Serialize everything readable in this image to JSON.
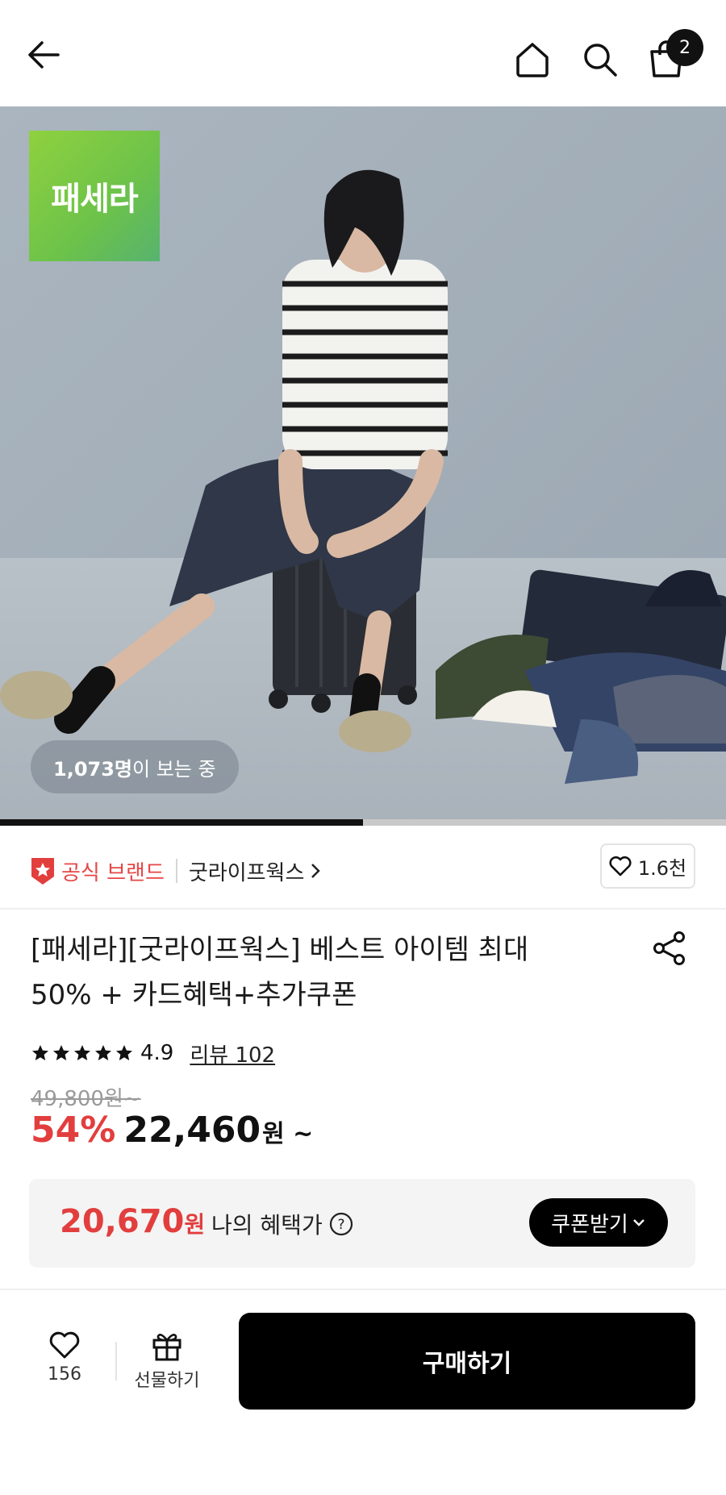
{
  "header": {
    "back_icon": "arrow-left-icon",
    "home_icon": "home-icon",
    "search_icon": "search-icon",
    "cart_icon": "shopping-bag-icon",
    "cart_badge": "2"
  },
  "hero": {
    "brand_logo_text": "패세라",
    "viewers_count": "1,073명",
    "viewers_suffix": "이 보는 중",
    "image_progress": 0.5
  },
  "brand": {
    "official_icon": "star-badge-icon",
    "official_label": "공식 브랜드",
    "brand_name": "굿라이프웍스",
    "like_count": "1.6천"
  },
  "product": {
    "title_line1": "[패세라][굿라이프웍스] 베스트 아이템 최대",
    "title_line2": "50% + 카드혜택+추가쿠폰",
    "share_icon": "share-icon",
    "rating": "4.9",
    "stars": 5,
    "review_label": "리뷰 102",
    "original_price": "49,800원~",
    "discount_rate": "54%",
    "price": "22,460",
    "price_unit": "원 ~"
  },
  "benefit": {
    "price": "20,670",
    "price_unit": "원",
    "label": "나의 혜택가",
    "help_icon": "question-circle-icon",
    "coupon_button": "쿠폰받기"
  },
  "bottom_bar": {
    "wish_count": "156",
    "gift_label": "선물하기",
    "buy_label": "구매하기"
  },
  "colors": {
    "accent_red": "#e23e3e",
    "brand_green": "#6cc24a"
  }
}
